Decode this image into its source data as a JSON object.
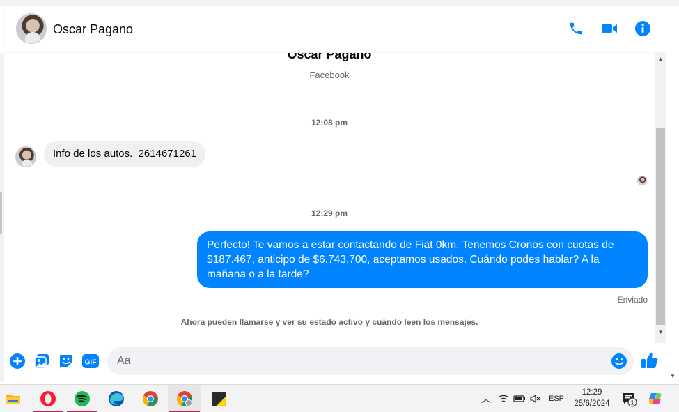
{
  "header": {
    "contact_name": "Oscar Pagano",
    "icons": [
      "phone-icon",
      "video-icon",
      "info-icon"
    ]
  },
  "conversation": {
    "profile_name": "Oscar Pagano",
    "profile_subtitle": "Facebook",
    "messages": [
      {
        "time": "12:08 pm",
        "direction": "incoming",
        "text": "Info de los autos.  2614671261"
      },
      {
        "time": "12:29 pm",
        "direction": "outgoing",
        "text": "Perfecto! Te vamos a estar contactando de Fiat 0km. Tenemos Cronos con cuotas de $187.467, anticipo de $6.743.700, aceptamos usados. Cuándo podes hablar? A la mañana o a la tarde?"
      }
    ],
    "sent_status": "Enviado",
    "info_notice": "Ahora pueden llamarse y ver su estado activo y cuándo leen los mensajes."
  },
  "composer": {
    "placeholder": "Aa",
    "icons": [
      "plus-icon",
      "image-icon",
      "sticker-icon",
      "gif-icon",
      "emoji-icon",
      "like-icon"
    ],
    "gif_label": "GIF"
  },
  "taskbar": {
    "apps": [
      "file-explorer-icon",
      "opera-icon",
      "spotify-icon",
      "edge-icon",
      "chrome-icon",
      "chrome-profile-icon",
      "sticky-notes-icon"
    ],
    "language": "ESP",
    "time": "12:29",
    "date": "25/6/2024",
    "notification_count": "1",
    "colors": {
      "accent": "#0084ff",
      "opera": "#ff1b2d",
      "spotify": "#1db954"
    }
  }
}
